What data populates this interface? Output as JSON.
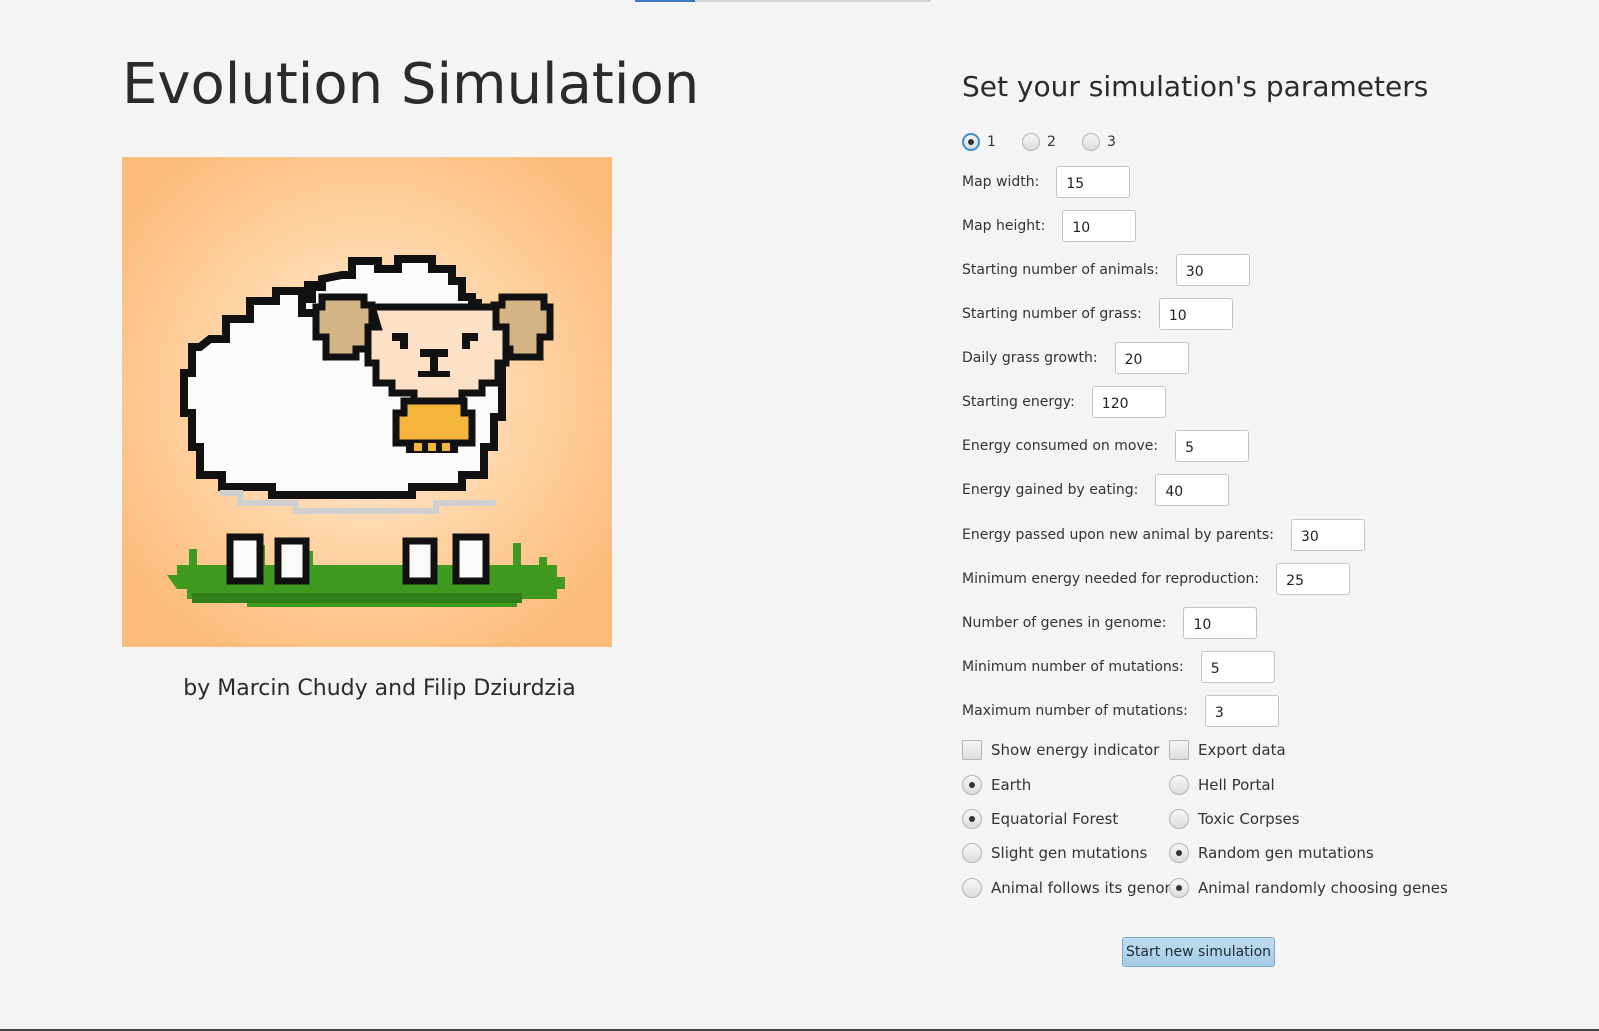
{
  "app": {
    "title": "Evolution Simulation",
    "authors": "by Marcin Chudy and Filip Dziurdzia",
    "image": "pixel-art-sheep"
  },
  "params": {
    "heading": "Set your simulation's parameters",
    "presets": [
      {
        "label": "1",
        "selected": true
      },
      {
        "label": "2",
        "selected": false
      },
      {
        "label": "3",
        "selected": false
      }
    ],
    "fields": [
      {
        "label": "Map width:",
        "value": "15"
      },
      {
        "label": "Map height:",
        "value": "10"
      },
      {
        "label": "Starting number of animals:",
        "value": "30"
      },
      {
        "label": "Starting number of grass:",
        "value": "10"
      },
      {
        "label": "Daily grass growth:",
        "value": "20"
      },
      {
        "label": "Starting energy:",
        "value": "120"
      },
      {
        "label": "Energy consumed on move:",
        "value": "5"
      },
      {
        "label": "Energy gained by eating:",
        "value": "40"
      },
      {
        "label": "Energy passed upon new animal by parents:",
        "value": "30"
      },
      {
        "label": "Minimum energy needed for reproduction:",
        "value": "25"
      },
      {
        "label": "Number of genes in genome:",
        "value": "10"
      },
      {
        "label": "Minimum number of mutations:",
        "value": "5"
      },
      {
        "label": "Maximum number of mutations:",
        "value": "3"
      }
    ],
    "checkboxes": {
      "show_energy": {
        "label": "Show energy indicator",
        "checked": false
      },
      "export_data": {
        "label": "Export data",
        "checked": false
      }
    },
    "options": {
      "map": {
        "left": {
          "label": "Earth",
          "selected": true
        },
        "right": {
          "label": "Hell Portal",
          "selected": false
        }
      },
      "grass": {
        "left": {
          "label": "Equatorial Forest",
          "selected": true
        },
        "right": {
          "label": "Toxic Corpses",
          "selected": false
        }
      },
      "mutation": {
        "left": {
          "label": "Slight gen mutations",
          "selected": false
        },
        "right": {
          "label": "Random gen mutations",
          "selected": true
        }
      },
      "behavior": {
        "left": {
          "label": "Animal follows its genome",
          "selected": false
        },
        "right": {
          "label": "Animal randomly choosing genes",
          "selected": true
        }
      }
    },
    "start_button": "Start new simulation"
  },
  "colors": {
    "background": "#f4f4f4",
    "button": "#a9cfe9",
    "focus": "#3c8ed6",
    "tab_accent": "#3f78c4"
  }
}
